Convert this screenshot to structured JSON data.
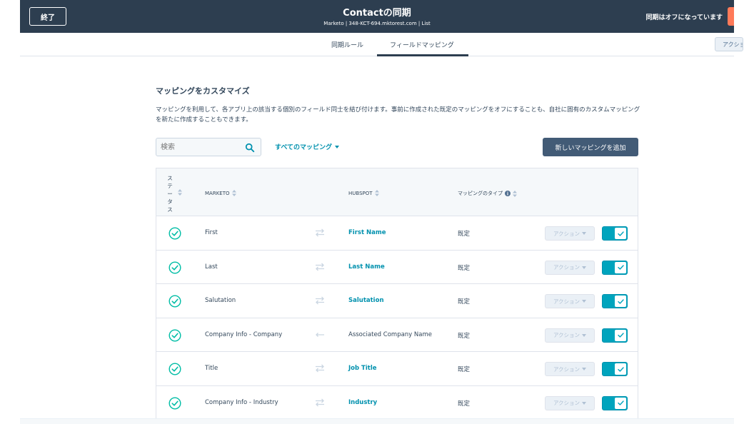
{
  "header": {
    "exit_label": "終了",
    "title": "Contactの同期",
    "subtitle": "Marketo | 348-KCT-694.mktorest.com | List",
    "sync_status": "同期はオフになっています",
    "accent_color": "#ff7a59",
    "bg_color": "#2d3e50"
  },
  "tabs": [
    {
      "label": "同期ルール",
      "active": false
    },
    {
      "label": "フィールドマッピング",
      "active": true
    }
  ],
  "tab_action_label": "アクション",
  "section": {
    "title": "マッピングをカスタマイズ",
    "description": "マッピングを利用して、各アプリ上の該当する個別のフィールド同士を結び付けます。事前に作成された既定のマッピングをオフにすることも、自社に固有のカスタムマッピングを新たに作成することもできます。"
  },
  "toolbar": {
    "search_placeholder": "検索",
    "filter_label": "すべてのマッピング",
    "add_button_label": "新しいマッピングを追加"
  },
  "table": {
    "headers": {
      "status": "ステータス",
      "marketo": "MARKETO",
      "hubspot": "HUBSPOT",
      "type": "マッピングのタイプ"
    },
    "action_label": "アクション",
    "rows": [
      {
        "marketo": "First",
        "direction": "two-way",
        "hubspot": "First Name",
        "hubspot_link": true,
        "type": "既定",
        "enabled": true
      },
      {
        "marketo": "Last",
        "direction": "two-way",
        "hubspot": "Last Name",
        "hubspot_link": true,
        "type": "既定",
        "enabled": true
      },
      {
        "marketo": "Salutation",
        "direction": "two-way",
        "hubspot": "Salutation",
        "hubspot_link": true,
        "type": "既定",
        "enabled": true
      },
      {
        "marketo": "Company Info - Company",
        "direction": "one-way-left",
        "hubspot": "Associated Company Name",
        "hubspot_link": false,
        "type": "既定",
        "enabled": true
      },
      {
        "marketo": "Title",
        "direction": "two-way",
        "hubspot": "Job Title",
        "hubspot_link": true,
        "type": "既定",
        "enabled": true
      },
      {
        "marketo": "Company Info - Industry",
        "direction": "two-way",
        "hubspot": "Industry",
        "hubspot_link": true,
        "type": "既定",
        "enabled": true
      }
    ]
  },
  "colors": {
    "link": "#0091ae",
    "toggle_on": "#00a4bd",
    "check": "#00bda5"
  }
}
